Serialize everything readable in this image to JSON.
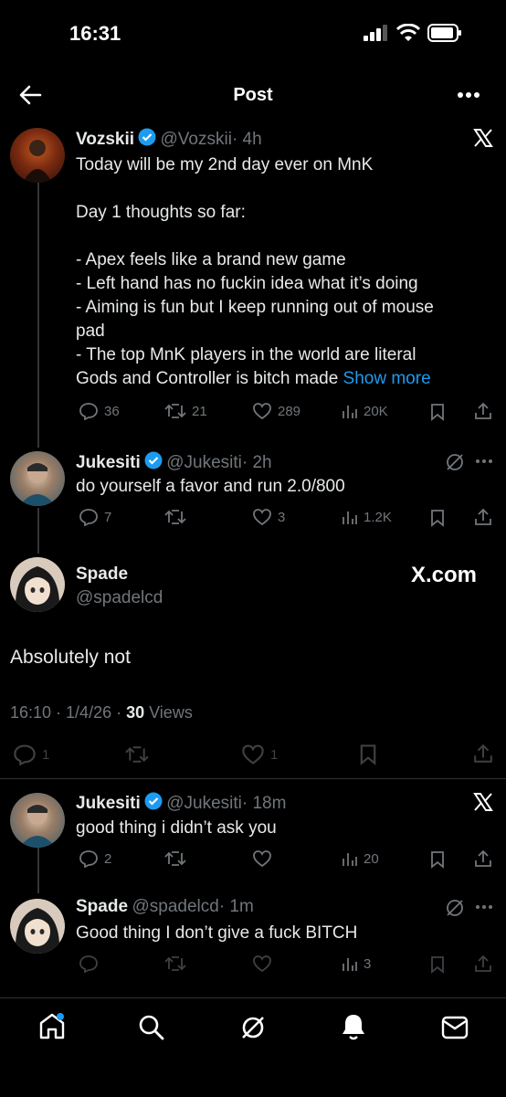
{
  "status": {
    "time": "16:31"
  },
  "header": {
    "title": "Post"
  },
  "post1": {
    "name": "Vozskii",
    "handle": "@Vozskii",
    "time": "· 4h",
    "lines": [
      "Today will be my 2nd day ever on MnK",
      "",
      "Day 1 thoughts so far:",
      "",
      "- Apex feels like a brand new game",
      "- Left hand has no fuckin idea what it’s doing",
      "- Aiming is fun but I keep running out of mouse",
      "pad",
      "- The top MnK players in the world are literal"
    ],
    "last_line": "Gods and Controller is bitch made",
    "show_more": "Show more",
    "replies": "36",
    "reposts": "21",
    "likes": "289",
    "views": "20K"
  },
  "post2": {
    "name": "Jukesiti",
    "handle": "@Jukesiti",
    "time": "· 2h",
    "text": "do yourself a favor and run 2.0/800",
    "replies": "7",
    "reposts": "",
    "likes": "3",
    "views": "1.2K"
  },
  "post3": {
    "name": "Spade",
    "handle": "@spadelcd",
    "watermark": "X.com",
    "text": "Absolutely not",
    "meta_time": "16:10 · 1/4/26 · ",
    "views_count": "30",
    "views_label": " Views",
    "replies": "1",
    "likes": "1"
  },
  "post4": {
    "name": "Jukesiti",
    "handle": "@Jukesiti",
    "time": "· 18m",
    "text": "good thing i didn’t ask you",
    "replies": "2",
    "views": "20"
  },
  "post5": {
    "name": "Spade",
    "handle": "@spadelcd",
    "time": "· 1m",
    "text": "Good thing I don’t give a fuck BITCH",
    "views": "3"
  },
  "colors": {
    "accent": "#1d9bf0",
    "muted": "#71767b",
    "background": "#000000"
  }
}
